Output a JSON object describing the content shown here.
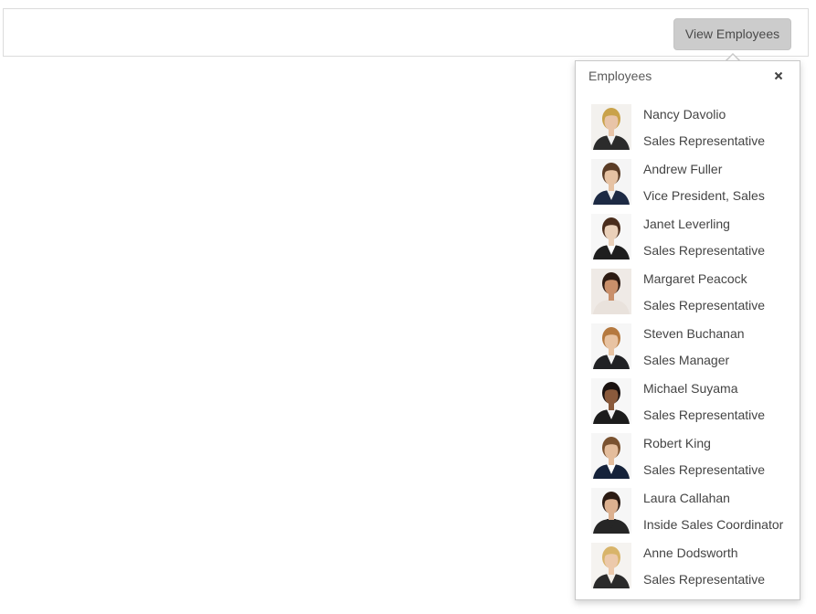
{
  "toolbar": {
    "button_label": "View Employees"
  },
  "popup": {
    "title": "Employees",
    "close_icon": "close-icon",
    "employees": [
      {
        "name": "Nancy Davolio",
        "title": "Sales Representative",
        "avatar": {
          "skin": "#e8c4a8",
          "hair": "#c9a24a",
          "suit": "#2b2b2b",
          "shirt": "#f2f2f2",
          "bg": "#f3f1ee"
        }
      },
      {
        "name": "Andrew Fuller",
        "title": "Vice President, Sales",
        "avatar": {
          "skin": "#e6c2a3",
          "hair": "#5a3c26",
          "suit": "#1d2a44",
          "shirt": "#f0f0f0",
          "bg": "#f5f5f5"
        }
      },
      {
        "name": "Janet Leverling",
        "title": "Sales Representative",
        "avatar": {
          "skin": "#ead0b9",
          "hair": "#4a2d1c",
          "suit": "#1e1e1e",
          "shirt": "#ffffff",
          "bg": "#f7f7f7"
        }
      },
      {
        "name": "Margaret Peacock",
        "title": "Sales Representative",
        "avatar": {
          "skin": "#c98f6a",
          "hair": "#2c1a12",
          "suit": "#e9e2dc",
          "shirt": "#e9e2dc",
          "bg": "#efeae6"
        }
      },
      {
        "name": "Steven Buchanan",
        "title": "Sales Manager",
        "avatar": {
          "skin": "#e8c3a2",
          "hair": "#b5793f",
          "suit": "#202124",
          "shirt": "#f3f3f3",
          "bg": "#f6f6f6"
        }
      },
      {
        "name": "Michael Suyama",
        "title": "Sales Representative",
        "avatar": {
          "skin": "#8a5a3c",
          "hair": "#1a1210",
          "suit": "#1c1c1c",
          "shirt": "#f4f4f4",
          "bg": "#f7f7f7"
        }
      },
      {
        "name": "Robert King",
        "title": "Sales Representative",
        "avatar": {
          "skin": "#e4bd9c",
          "hair": "#7a5230",
          "suit": "#15223a",
          "shirt": "#ffffff",
          "bg": "#f6f6f6"
        }
      },
      {
        "name": "Laura Callahan",
        "title": "Inside Sales Coordinator",
        "avatar": {
          "skin": "#dcb08f",
          "hair": "#2a1a12",
          "suit": "#262626",
          "shirt": "#262626",
          "bg": "#f6f6f6"
        }
      },
      {
        "name": "Anne Dodsworth",
        "title": "Sales Representative",
        "avatar": {
          "skin": "#ecc9ab",
          "hair": "#d8b46a",
          "suit": "#2a2a2a",
          "shirt": "#f4efe9",
          "bg": "#f5f3f0"
        }
      }
    ]
  }
}
